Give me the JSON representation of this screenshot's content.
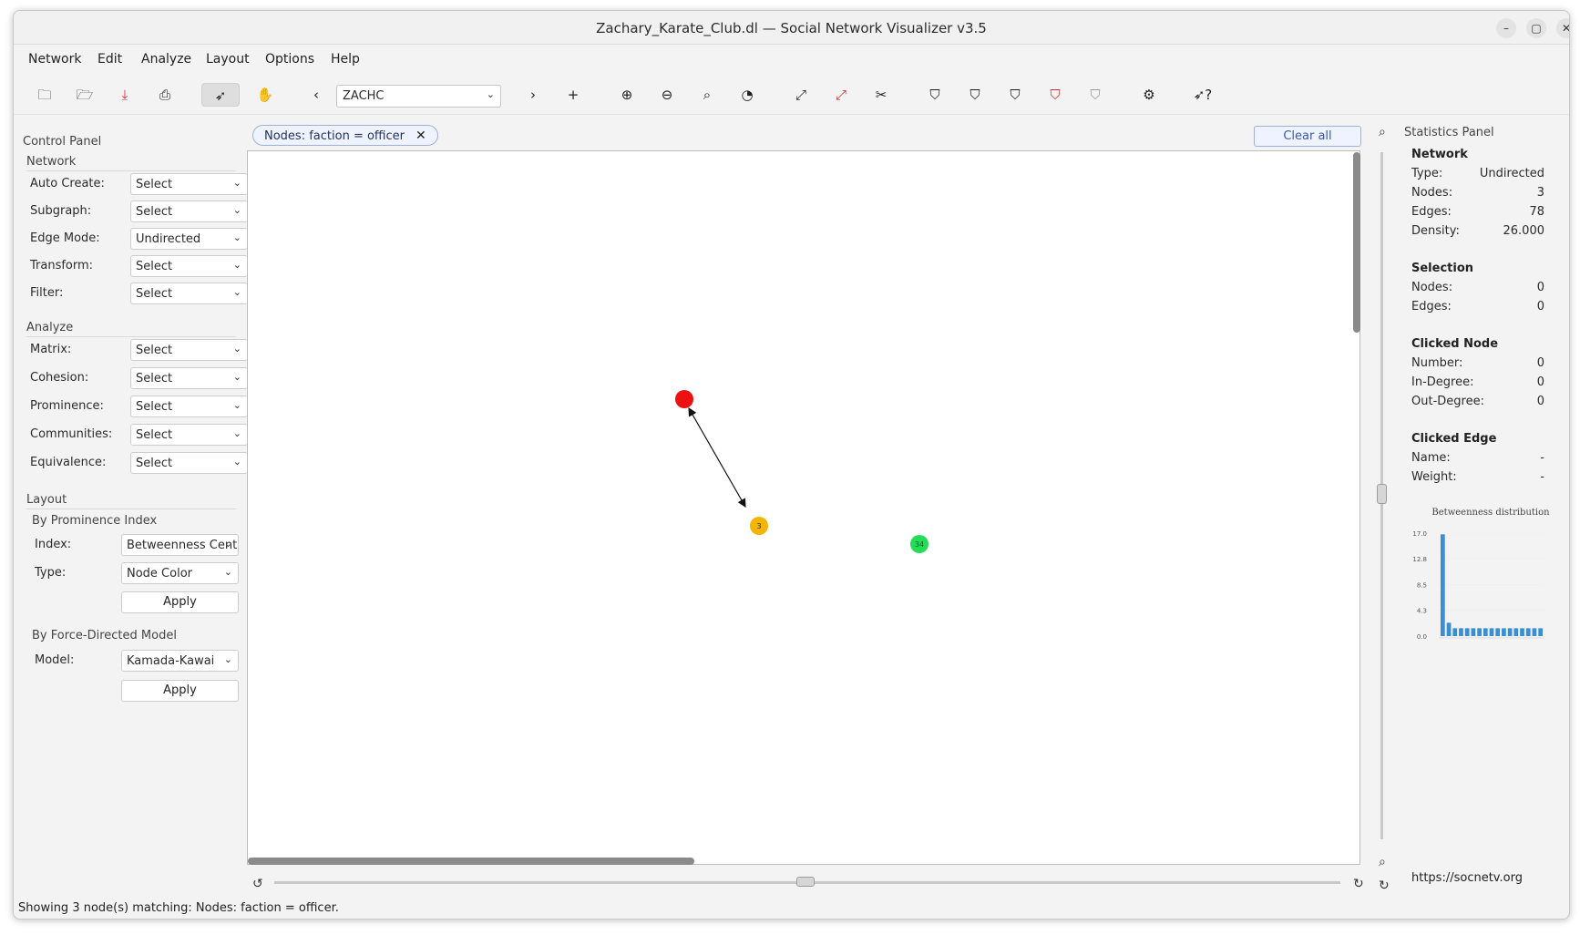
{
  "window": {
    "title": "Zachary_Karate_Club.dl — Social Network Visualizer v3.5"
  },
  "menubar": {
    "items": [
      "Network",
      "Edit",
      "Analyze",
      "Layout",
      "Options",
      "Help"
    ]
  },
  "toolbar": {
    "relation_combo": "ZACHC"
  },
  "control_panel": {
    "title": "Control Panel",
    "network": {
      "heading": "Network",
      "rows": [
        {
          "label": "Auto Create:",
          "value": "Select"
        },
        {
          "label": "Subgraph:",
          "value": "Select"
        },
        {
          "label": "Edge Mode:",
          "value": "Undirected"
        },
        {
          "label": "Transform:",
          "value": "Select"
        },
        {
          "label": "Filter:",
          "value": "Select"
        }
      ]
    },
    "analyze": {
      "heading": "Analyze",
      "rows": [
        {
          "label": "Matrix:",
          "value": "Select"
        },
        {
          "label": "Cohesion:",
          "value": "Select"
        },
        {
          "label": "Prominence:",
          "value": "Select"
        },
        {
          "label": "Communities:",
          "value": "Select"
        },
        {
          "label": "Equivalence:",
          "value": "Select"
        }
      ]
    },
    "layout": {
      "heading": "Layout",
      "prominence_heading": "By Prominence Index",
      "index_label": "Index:",
      "index_value": "Betweenness Cent",
      "type_label": "Type:",
      "type_value": "Node Color",
      "apply_label": "Apply",
      "force_heading": "By Force-Directed Model",
      "model_label": "Model:",
      "model_value": "Kamada-Kawai",
      "apply2_label": "Apply"
    }
  },
  "filter_chip": {
    "label": "Nodes: faction = officer"
  },
  "clear_all": "Clear all",
  "graph": {
    "nodes": [
      {
        "label": "",
        "color": "#ee1111"
      },
      {
        "label": "3",
        "color": "#f4b400"
      },
      {
        "label": "34",
        "color": "#22dd55"
      }
    ]
  },
  "stats_panel": {
    "title": "Statistics Panel",
    "network": {
      "heading": "Network",
      "rows": [
        {
          "k": "Type:",
          "v": "Undirected"
        },
        {
          "k": "Nodes:",
          "v": "3"
        },
        {
          "k": "Edges:",
          "v": "78"
        },
        {
          "k": "Density:",
          "v": "26.000"
        }
      ]
    },
    "selection": {
      "heading": "Selection",
      "rows": [
        {
          "k": "Nodes:",
          "v": "0"
        },
        {
          "k": "Edges:",
          "v": "0"
        }
      ]
    },
    "clicked_node": {
      "heading": "Clicked Node",
      "rows": [
        {
          "k": "Number:",
          "v": "0"
        },
        {
          "k": "In-Degree:",
          "v": "0"
        },
        {
          "k": "Out-Degree:",
          "v": "0"
        }
      ]
    },
    "clicked_edge": {
      "heading": "Clicked Edge",
      "rows": [
        {
          "k": "Name:",
          "v": "-"
        },
        {
          "k": "Weight:",
          "v": "-"
        }
      ]
    },
    "link": "https://socnetv.org"
  },
  "chart_data": {
    "type": "bar",
    "title": "Betweenness distribution",
    "yticks": [
      "17.0",
      "12.8",
      "8.5",
      "4.3",
      "0.0"
    ],
    "ylim": [
      0,
      17
    ],
    "values": [
      16.8,
      2.2,
      1.3,
      1.3,
      1.3,
      1.3,
      1.3,
      1.3,
      1.3,
      1.3,
      1.3,
      1.3,
      1.3,
      1.3,
      1.3,
      1.3,
      1.3
    ],
    "color": "#3a8fd4"
  },
  "statusbar": {
    "text": "Showing 3 node(s) matching: Nodes: faction = officer."
  }
}
